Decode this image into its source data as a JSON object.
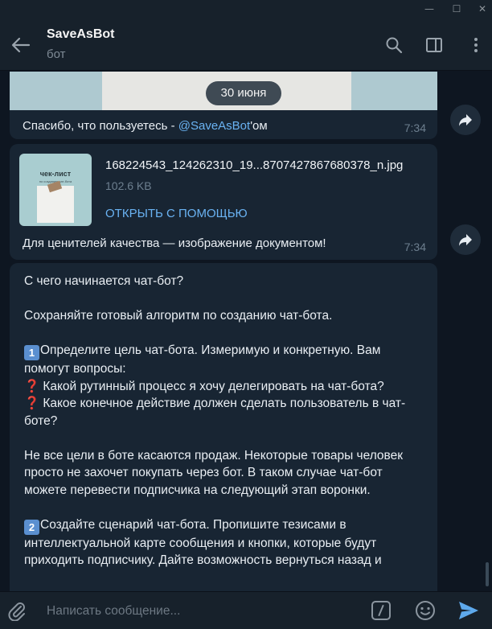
{
  "window": {
    "minimize": "—",
    "maximize": "☐",
    "close": "✕"
  },
  "header": {
    "title": "SaveAsBot",
    "subtitle": "бот"
  },
  "date_pill": "30 июня",
  "messages": [
    {
      "caption_prefix": "Спасибо, что пользуетесь - ",
      "mention": "@SaveAsBot",
      "caption_suffix": "'ом",
      "time": "7:34"
    },
    {
      "thumb_title": "чек-лист",
      "thumb_subtitle": "по созданию чат-бота",
      "file_name": "168224543_124262310_19...8707427867680378_n.jpg",
      "file_size": "102.6 KB",
      "open_with": "ОТКРЫТЬ С ПОМОЩЬЮ",
      "caption": "Для ценителей качества — изображение документом!",
      "time": "7:34"
    },
    {
      "p1": "С чего начинается чат-бот?",
      "p2": "Сохраняйте готовый алгоритм по созданию чат-бота.",
      "num1": "1",
      "p3": "Определите цель чат-бота. Измеримую и конкретную. Вам помогут вопросы:",
      "q_mark": "❓",
      "q1": "Какой рутинный процесс я хочу делегировать на чат-бота?",
      "q2": "Какое конечное действие должен сделать пользователь в чат-боте?",
      "p4": "Не все цели в боте касаются продаж. Некоторые товары человек просто не захочет покупать через бот. В таком случае чат-бот можете перевести подписчика на следующий этап воронки.",
      "num2": "2",
      "p5": "Создайте сценарий чат-бота. Пропишите тезисами в интеллектуальной карте сообщения и кнопки, которые будут приходить подписчику. Дайте возможность вернуться назад и"
    }
  ],
  "composer": {
    "placeholder": "Написать сообщение..."
  },
  "colors": {
    "background": "#0e1621",
    "panel": "#17212b",
    "bubble": "#182533",
    "accent": "#6ab3f3",
    "muted": "#6d7f8f"
  }
}
